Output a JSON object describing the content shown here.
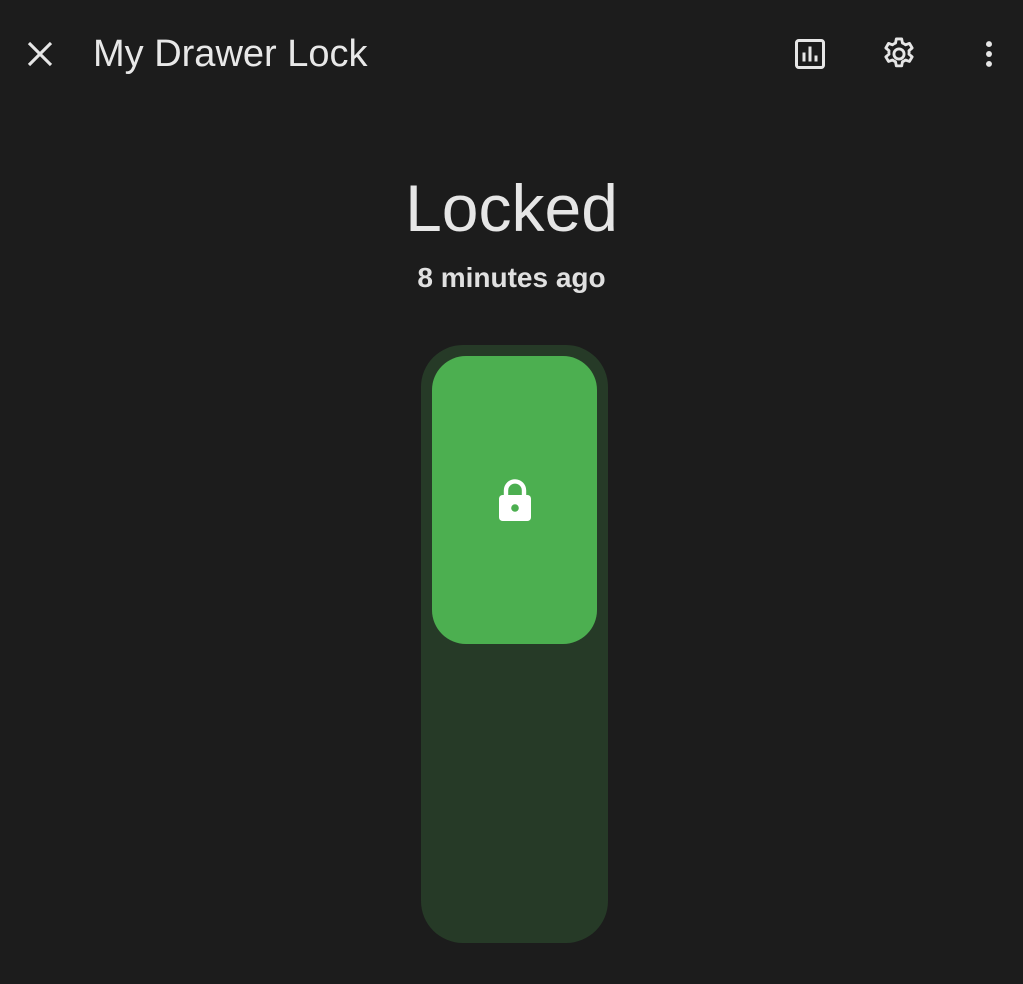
{
  "header": {
    "title": "My Drawer Lock",
    "icons": {
      "close": "close-icon",
      "history": "chart-box-icon",
      "settings": "gear-icon",
      "more": "dots-vertical-icon"
    }
  },
  "lock": {
    "state": "Locked",
    "last_changed": "8 minutes ago",
    "icon": "lock-icon",
    "is_locked": true
  },
  "colors": {
    "background": "#1c1c1c",
    "track": "#263a27",
    "thumb": "#4caf50",
    "text": "#e6e6e6"
  }
}
